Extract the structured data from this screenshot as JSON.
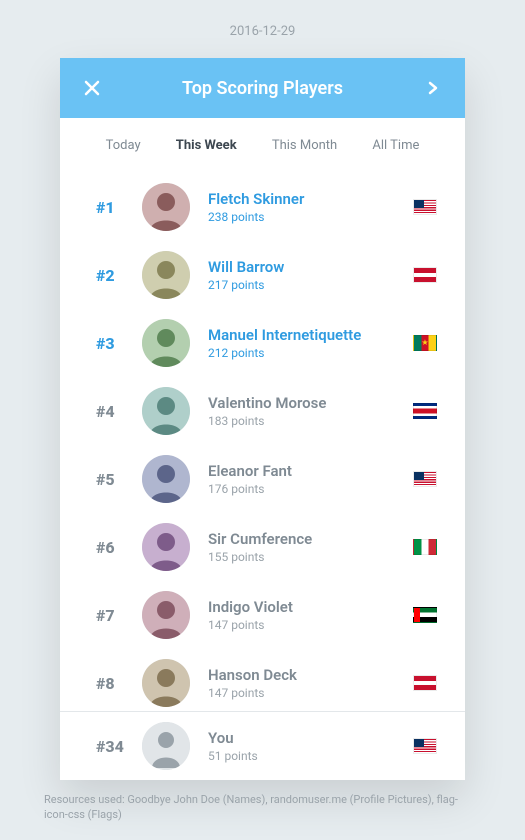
{
  "date": "2016-12-29",
  "header": {
    "title": "Top Scoring Players"
  },
  "tabs": [
    {
      "label": "Today",
      "active": false
    },
    {
      "label": "This Week",
      "active": true
    },
    {
      "label": "This Month",
      "active": false
    },
    {
      "label": "All Time",
      "active": false
    }
  ],
  "players": [
    {
      "rank": "#1",
      "name": "Fletch Skinner",
      "points": "238 points",
      "flag": "us",
      "top3": true
    },
    {
      "rank": "#2",
      "name": "Will Barrow",
      "points": "217 points",
      "flag": "at",
      "top3": true
    },
    {
      "rank": "#3",
      "name": "Manuel Internetiquette",
      "points": "212 points",
      "flag": "cm",
      "top3": true
    },
    {
      "rank": "#4",
      "name": "Valentino Morose",
      "points": "183 points",
      "flag": "cr",
      "top3": false
    },
    {
      "rank": "#5",
      "name": "Eleanor Fant",
      "points": "176 points",
      "flag": "us",
      "top3": false
    },
    {
      "rank": "#6",
      "name": "Sir Cumference",
      "points": "155 points",
      "flag": "it",
      "top3": false
    },
    {
      "rank": "#7",
      "name": "Indigo Violet",
      "points": "147 points",
      "flag": "ae",
      "top3": false
    },
    {
      "rank": "#8",
      "name": "Hanson Deck",
      "points": "147 points",
      "flag": "at",
      "top3": false
    }
  ],
  "you": {
    "rank": "#34",
    "name": "You",
    "points": "51 points",
    "flag": "us"
  },
  "footer": "Resources used: Goodbye John Doe (Names), randomuser.me (Profile Pictures), flag-icon-css (Flags)"
}
